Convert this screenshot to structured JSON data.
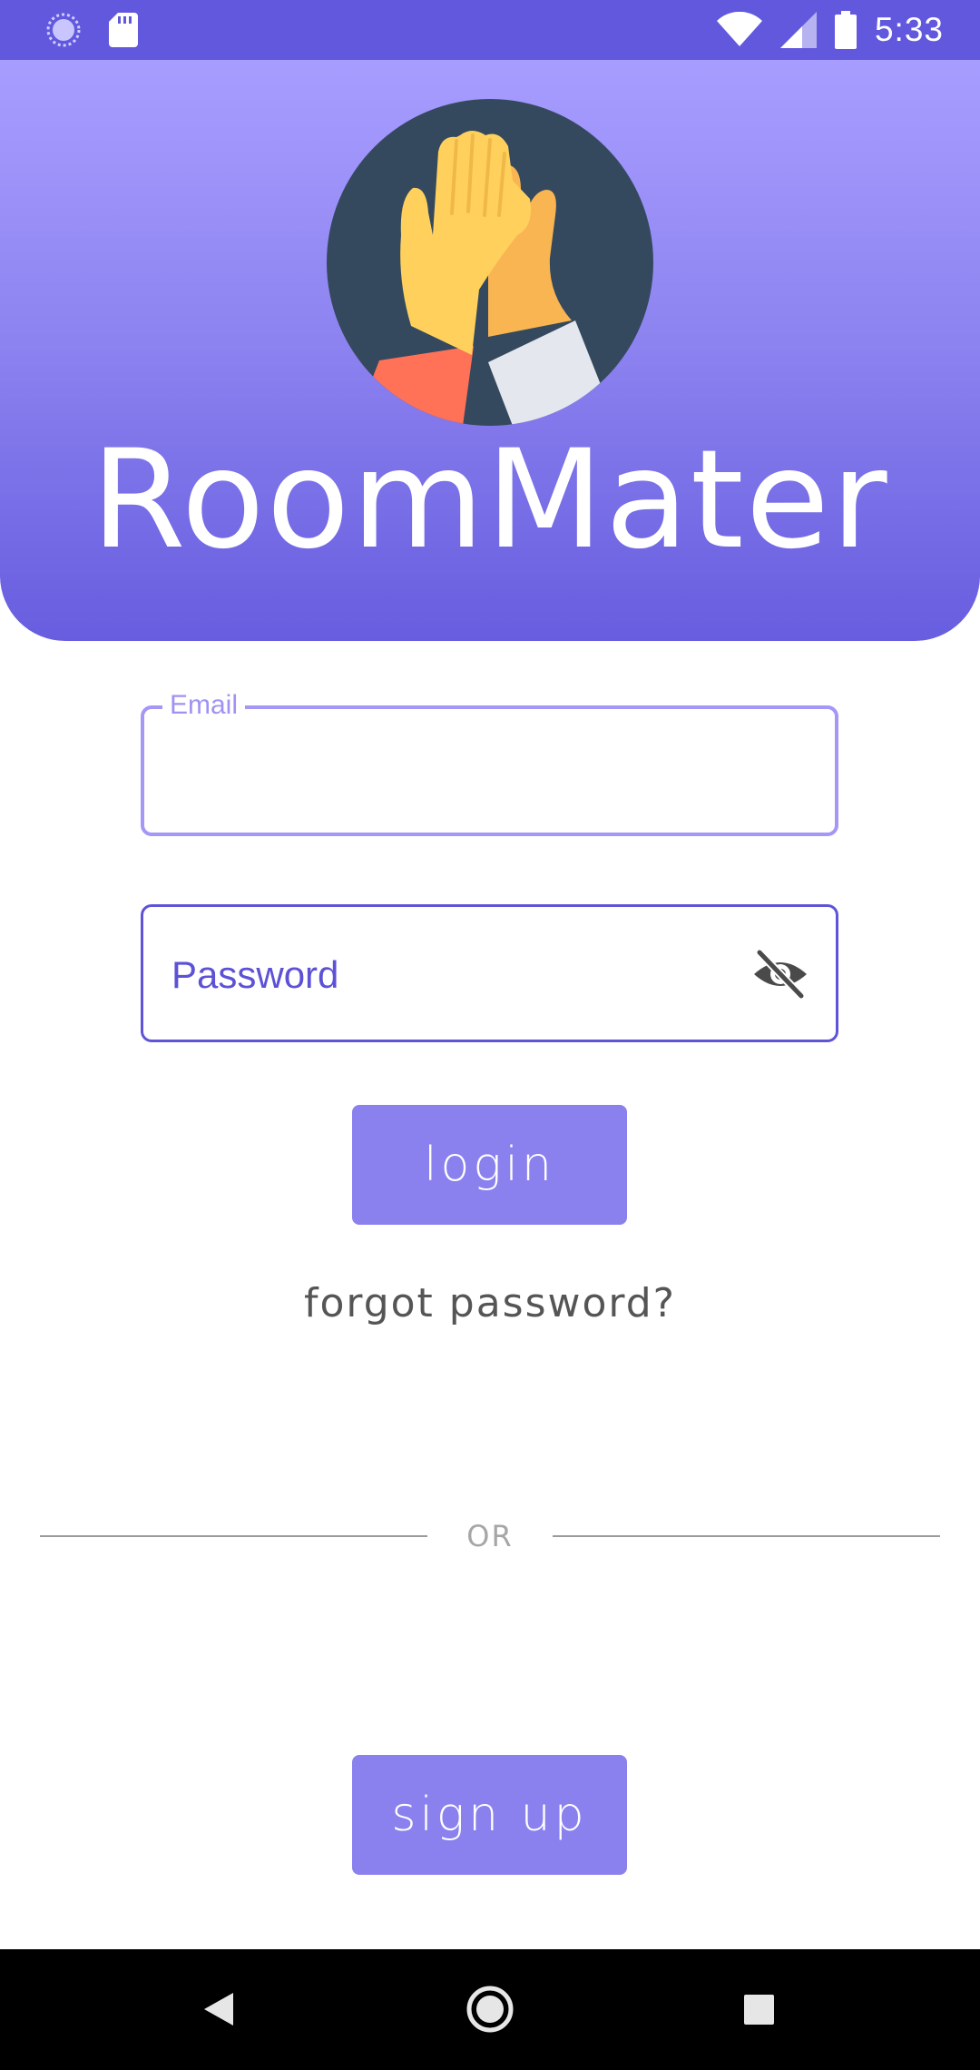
{
  "status_bar": {
    "time": "5:33",
    "icons": [
      "loading-icon",
      "sd-card-icon",
      "wifi-icon",
      "cell-signal-icon",
      "battery-icon"
    ]
  },
  "header": {
    "app_title": "RoomMater",
    "logo_icon": "high-five-icon"
  },
  "form": {
    "email_label": "Email",
    "email_value": "",
    "password_label": "Password",
    "password_toggle_icon": "eye-off-icon"
  },
  "actions": {
    "login_label": "login",
    "forgot_label": "forgot password?",
    "divider_text": "OR",
    "signup_label": "sign up"
  },
  "nav_bar": {
    "icons": [
      "back-icon",
      "home-icon",
      "recents-icon"
    ]
  },
  "colors": {
    "primary": "#6258de",
    "header_gradient_top": "#a79dff",
    "header_gradient_bottom": "#675ddf",
    "button": "#8a80ee",
    "email_border": "#a497f5",
    "password_border": "#5f53d8"
  }
}
